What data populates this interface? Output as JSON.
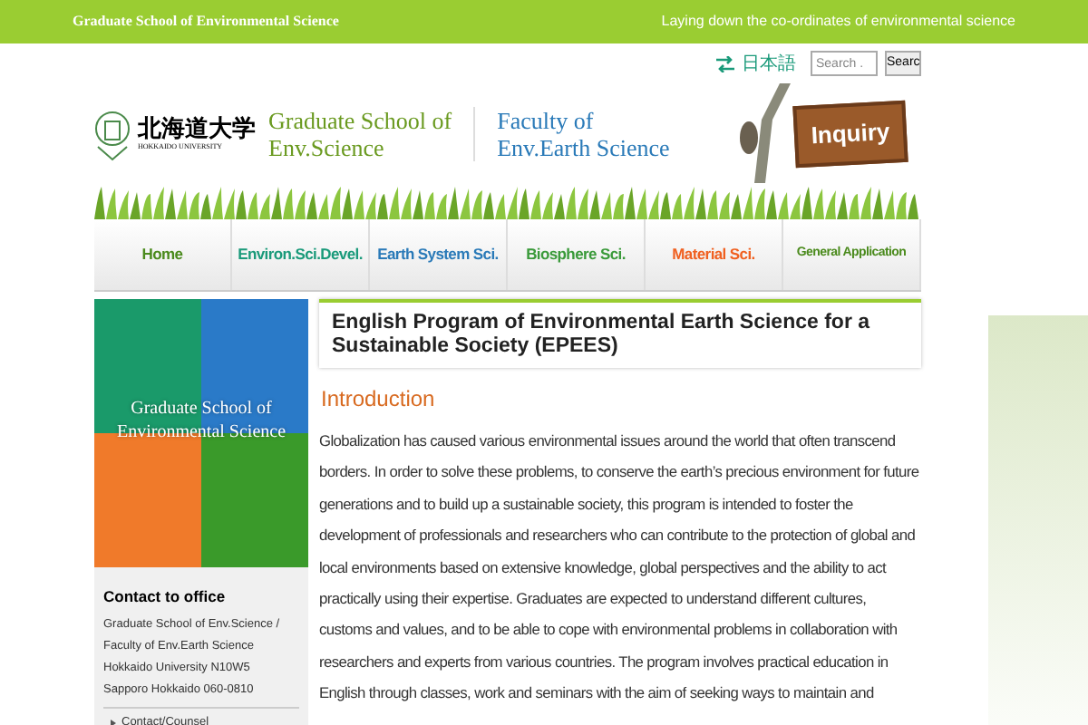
{
  "top_bar": {
    "title": "Graduate School of Environmental Science",
    "tagline": "Laying down the co-ordinates of environmental science"
  },
  "utility": {
    "language_link": "日本語",
    "search": {
      "placeholder": "Search .",
      "button": "Searc"
    }
  },
  "header": {
    "logo_kanji": "北海道大学",
    "logo_roman": "HOKKAIDO UNIVERSITY",
    "school": [
      "Graduate School of",
      "Env.Science"
    ],
    "faculty": [
      "Faculty of",
      "Env.Earth Science"
    ],
    "inquiry": "Inquiry"
  },
  "nav": [
    {
      "label": "Home",
      "color": "#4a8a1c",
      "selected": false
    },
    {
      "label": "Environ.Sci.Devel.",
      "color": "#1a9a7a",
      "selected": false
    },
    {
      "label": "Earth System Sci.",
      "color": "#2a7ab8",
      "selected": false
    },
    {
      "label": "Biosphere Sci.",
      "color": "#3a9a3a",
      "selected": false
    },
    {
      "label": "Material Sci.",
      "color": "#f06020",
      "selected": false
    },
    {
      "label": "General Application",
      "color": "#4a8a1c",
      "selected": false
    }
  ],
  "sidebar": {
    "banner_text": [
      "Graduate School of",
      "Environmental Science"
    ],
    "contact_title": "Contact to office",
    "address": [
      "Graduate School of Env.Science /",
      "Faculty of Env.Earth Science",
      "Hokkaido University N10W5",
      "Sapporo Hokkaido 060-0810"
    ],
    "links": [
      "Contact/Counsel"
    ]
  },
  "main": {
    "title": "English Program of Environmental Earth Science for a Sustainable Society (EPEES)",
    "section_heading": "Introduction",
    "paragraph": "Globalization has caused various environmental issues around the world that often transcend borders. In order to solve these problems, to conserve the earth’s precious environment for future generations and to build up a sustainable society, this program is intended to foster the development of professionals and researchers who can contribute to the protection of global and local environments based on extensive knowledge, global perspectives and the ability to act practically using their expertise. Graduates are expected to understand different cultures, customs and values, and to be able to cope with environmental problems in collaboration with researchers and experts from various countries. The program involves practical education in English through classes, work and seminars with the aim of seeking ways to maintain and"
  }
}
